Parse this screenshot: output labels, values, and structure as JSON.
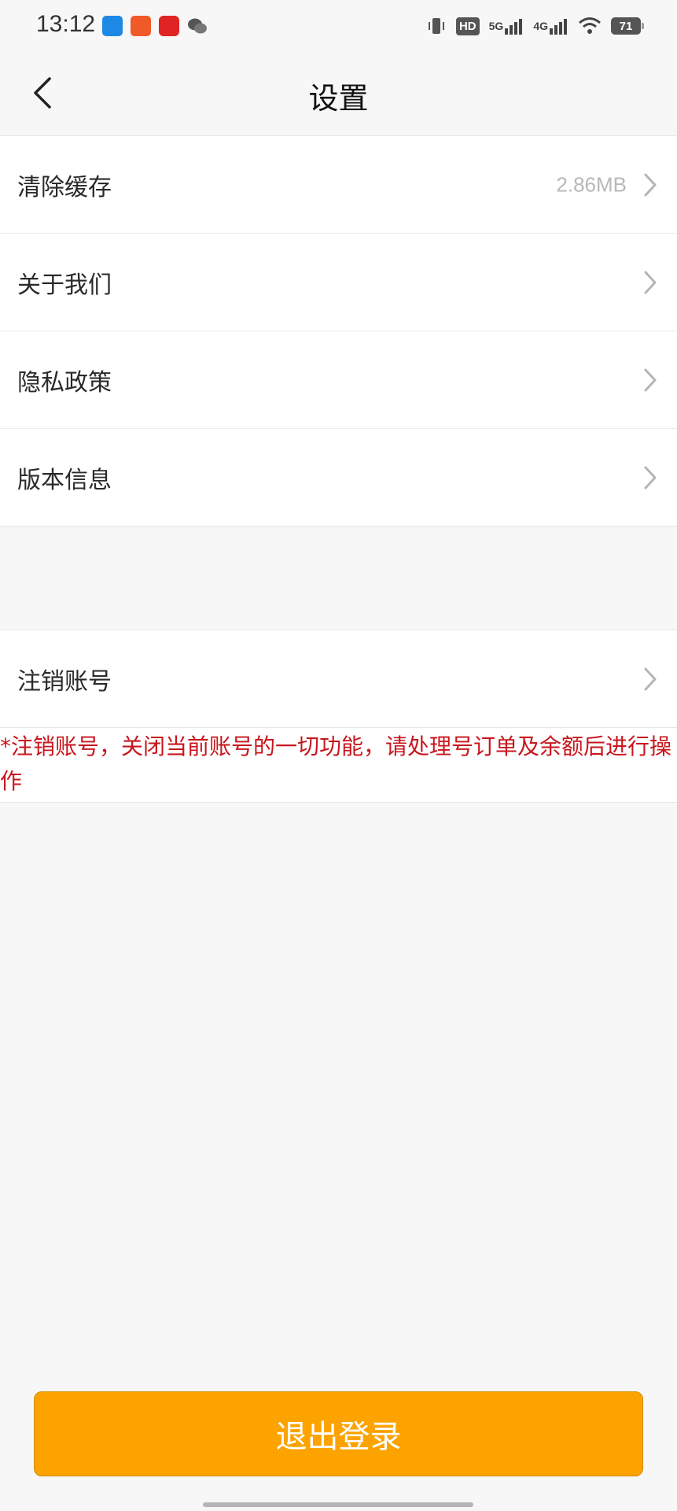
{
  "status_bar": {
    "time": "13:12",
    "hd_label": "HD",
    "net_5g": "5G",
    "net_4g": "4G",
    "battery": "71",
    "app_icons": [
      "blue-app-icon",
      "taobao-icon",
      "netease-music-icon",
      "wechat-icon"
    ]
  },
  "header": {
    "title": "设置"
  },
  "menu": {
    "items": [
      {
        "label": "清除缓存",
        "value": "2.86MB"
      },
      {
        "label": "关于我们"
      },
      {
        "label": "隐私政策"
      },
      {
        "label": "版本信息"
      }
    ],
    "account_items": [
      {
        "label": "注销账号"
      }
    ]
  },
  "warning_text": "*注销账号，关闭当前账号的一切功能，请处理号订单及余额后进行操作",
  "logout_label": "退出登录",
  "colors": {
    "accent": "#fca300",
    "warning": "#c8161d",
    "background": "#f7f7f7"
  }
}
